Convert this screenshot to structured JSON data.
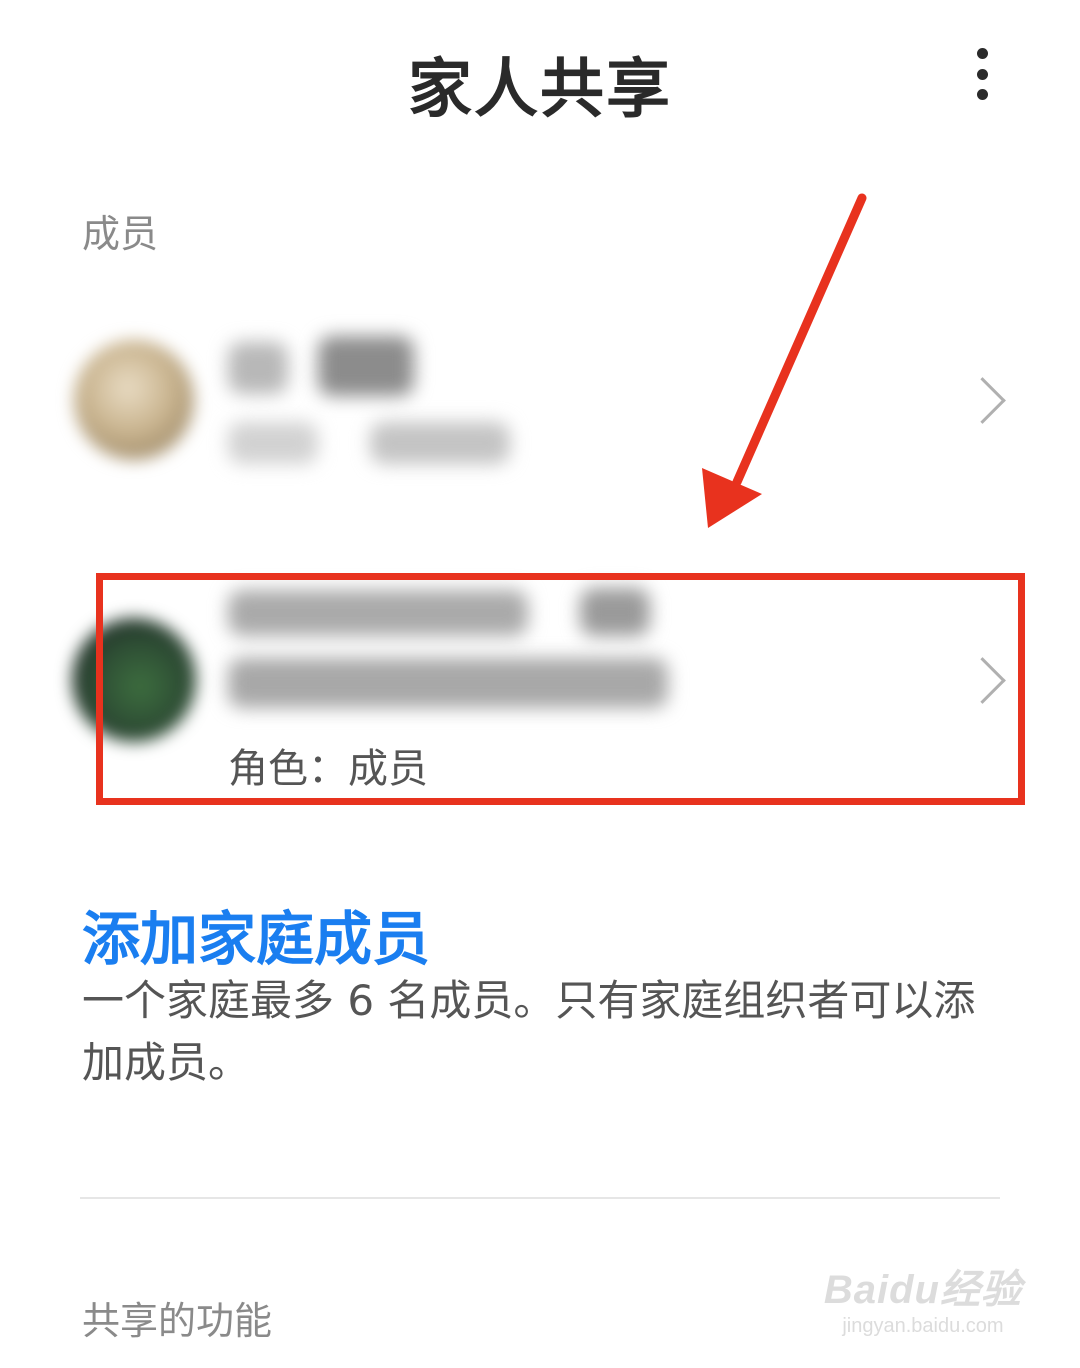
{
  "header": {
    "title": "家人共享",
    "more_icon": "more-vertical-icon"
  },
  "members_section": {
    "label": "成员",
    "members": [
      {
        "role": ""
      },
      {
        "role": "角色：成员"
      }
    ]
  },
  "add_member": {
    "title": "添加家庭成员",
    "description": "一个家庭最多 6 名成员。只有家庭组织者可以添加成员。"
  },
  "shared_features": {
    "label": "共享的功能"
  },
  "watermark": {
    "main": "Baidu经验",
    "sub": "jingyan.baidu.com"
  },
  "colors": {
    "accent": "#1a7ef0",
    "annotation": "#e8321e"
  }
}
